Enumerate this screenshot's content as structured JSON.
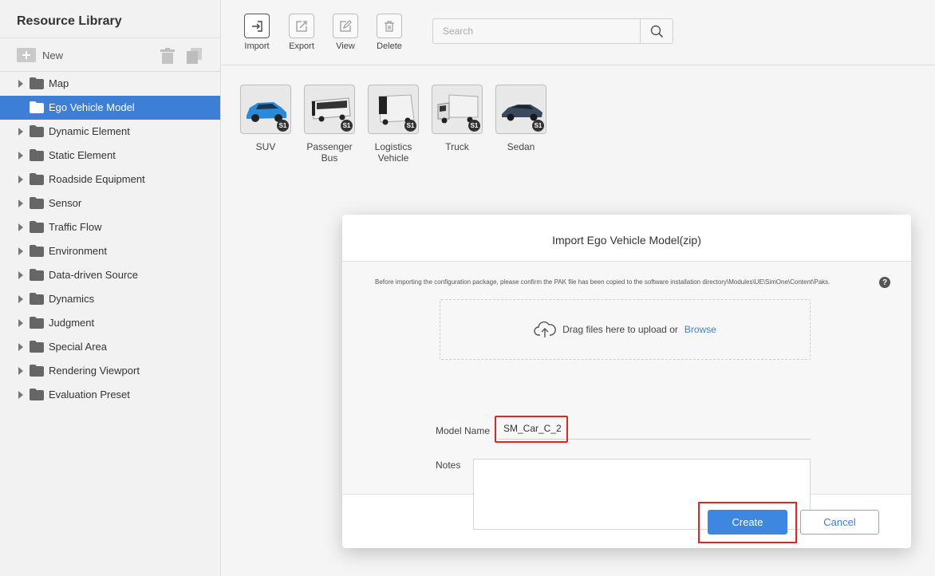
{
  "sidebar": {
    "title": "Resource Library",
    "new_label": "New",
    "items": [
      {
        "label": "Map"
      },
      {
        "label": "Ego Vehicle Model"
      },
      {
        "label": "Dynamic Element"
      },
      {
        "label": "Static Element"
      },
      {
        "label": "Roadside Equipment"
      },
      {
        "label": "Sensor"
      },
      {
        "label": "Traffic Flow"
      },
      {
        "label": "Environment"
      },
      {
        "label": "Data-driven Source"
      },
      {
        "label": "Dynamics"
      },
      {
        "label": "Judgment"
      },
      {
        "label": "Special Area"
      },
      {
        "label": "Rendering Viewport"
      },
      {
        "label": "Evaluation Preset"
      }
    ],
    "selected_index": 1
  },
  "toolbar": {
    "import_label": "Import",
    "export_label": "Export",
    "view_label": "View",
    "delete_label": "Delete",
    "search_placeholder": "Search"
  },
  "vehicles": [
    {
      "name": "SUV",
      "badge": "S1",
      "color": "#2b8ad8"
    },
    {
      "name": "Passenger Bus",
      "badge": "S1",
      "color": "#f0f0f0"
    },
    {
      "name": "Logistics Vehicle",
      "badge": "S1",
      "color": "#f2f2f2"
    },
    {
      "name": "Truck",
      "badge": "S1",
      "color": "#f2f2f2"
    },
    {
      "name": "Sedan",
      "badge": "S1",
      "color": "#3a4a5e"
    }
  ],
  "dialog": {
    "title": "Import Ego Vehicle Model(zip)",
    "notice": "Before importing the configuration package, please confirm the PAK file has been copied to the software installation directory\\Modules\\UE\\SimOne\\Content\\Paks.",
    "help": "?",
    "drop_text": "Drag files here to upload or",
    "browse_label": "Browse",
    "model_name_label": "Model Name",
    "model_name_value": "SM_Car_C_2",
    "notes_label": "Notes",
    "notes_value": "",
    "create_label": "Create",
    "cancel_label": "Cancel"
  },
  "colors": {
    "accent": "#3d7fd6",
    "highlight": "#e02525"
  }
}
